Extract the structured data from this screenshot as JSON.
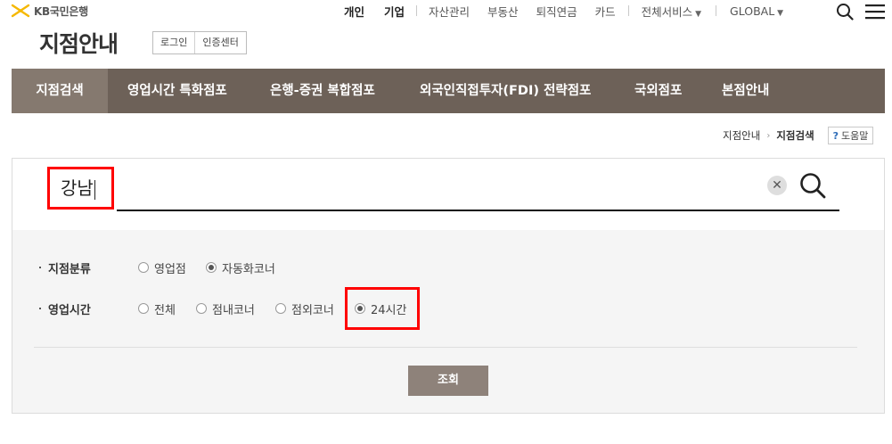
{
  "brand": {
    "logo_text": "KB국민은행",
    "accent": "#f5b800"
  },
  "topnav": {
    "personal": "개인",
    "business": "기업",
    "asset": "자산관리",
    "realestate": "부동산",
    "pension": "퇴직연금",
    "card": "카드",
    "all_services": "전체서비스",
    "global": "GLOBAL"
  },
  "header": {
    "title": "지점안내",
    "login": "로그인",
    "cert_center": "인증센터"
  },
  "tabs": [
    {
      "label": "지점검색"
    },
    {
      "label": "영업시간 특화점포"
    },
    {
      "label": "은행-증권 복합점포"
    },
    {
      "label": "외국인직접투자(FDI) 전략점포"
    },
    {
      "label": "국외점포"
    },
    {
      "label": "본점안내"
    }
  ],
  "breadcrumb": {
    "parent": "지점안내",
    "current": "지점검색",
    "help": "도움말"
  },
  "search": {
    "value": "강남",
    "clear_icon": "close-icon",
    "search_icon": "search-icon"
  },
  "filters": {
    "branch_type": {
      "label": "지점분류",
      "options": [
        "영업점",
        "자동화코너"
      ],
      "selected": "자동화코너"
    },
    "hours": {
      "label": "영업시간",
      "options": [
        "전체",
        "점내코너",
        "점외코너",
        "24시간"
      ],
      "selected": "24시간"
    }
  },
  "submit_label": "조회",
  "colors": {
    "tabbar": "#6d6158",
    "tab_active": "#85796f",
    "submit": "#8e827a",
    "highlight": "#ff0000"
  }
}
